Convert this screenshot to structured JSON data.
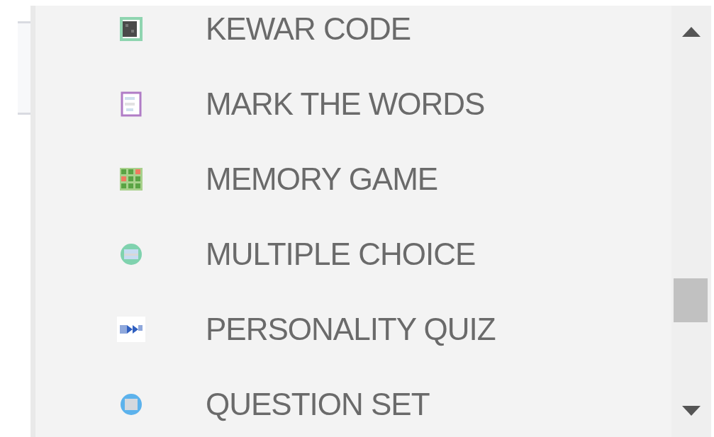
{
  "items": [
    {
      "label": "KEWAR CODE",
      "kind": "qr"
    },
    {
      "label": "MARK THE WORDS",
      "kind": "page"
    },
    {
      "label": "MEMORY GAME",
      "kind": "grid"
    },
    {
      "label": "MULTIPLE CHOICE",
      "kind": "round-green"
    },
    {
      "label": "PERSONALITY QUIZ",
      "kind": "arrows"
    },
    {
      "label": "QUESTION SET",
      "kind": "round-blue"
    }
  ]
}
